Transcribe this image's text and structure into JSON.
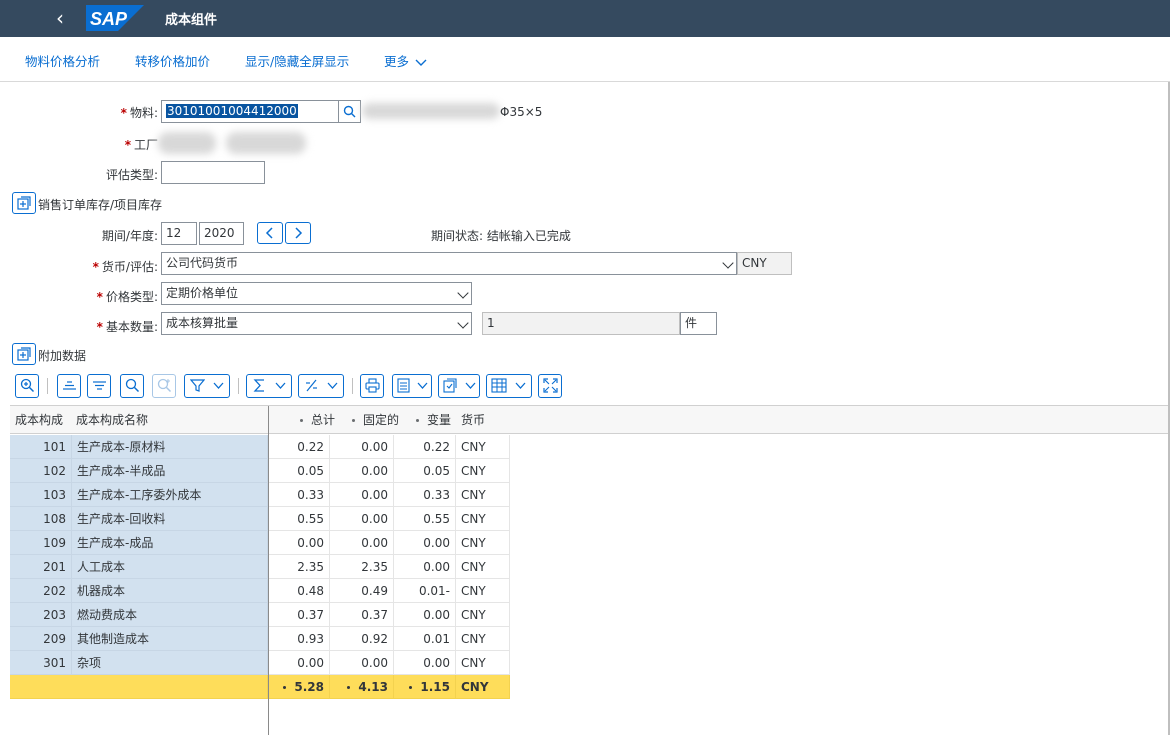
{
  "shell": {
    "title": "成本组件",
    "logo_text": "SAP"
  },
  "toolbar": {
    "items": [
      "物料价格分析",
      "转移价格加价",
      "显示/隐藏全屏显示",
      "更多"
    ]
  },
  "form": {
    "material_label": "物料:",
    "material_value": "30101001004412000",
    "material_desc_suffix": "Φ35×5",
    "plant_label": "工厂",
    "valuation_type_label": "评估类型:",
    "valuation_type_value": "",
    "sales_order_stock": "销售订单库存/项目库存",
    "period_label": "期间/年度:",
    "period_value": "12",
    "year_value": "2020",
    "period_status": "期间状态: 结帐输入已完成",
    "currency_label": "货币/评估:",
    "currency_value": "公司代码货币",
    "currency_code": "CNY",
    "price_type_label": "价格类型:",
    "price_type_value": "定期价格单位",
    "base_qty_label": "基本数量:",
    "base_qty_value": "成本核算批量",
    "base_qty_number": "1",
    "base_qty_unit": "件",
    "additional_data": "附加数据"
  },
  "grid": {
    "headers": {
      "component": "成本构成",
      "component_name": "成本构成名称",
      "total": "总计",
      "fixed": "固定的",
      "variable": "变量",
      "currency": "货币"
    },
    "rows": [
      {
        "code": "101",
        "name": "生产成本-原材料",
        "total": "0.22",
        "fixed": "0.00",
        "variable": "0.22",
        "currency": "CNY"
      },
      {
        "code": "102",
        "name": "生产成本-半成品",
        "total": "0.05",
        "fixed": "0.00",
        "variable": "0.05",
        "currency": "CNY"
      },
      {
        "code": "103",
        "name": "生产成本-工序委外成本",
        "total": "0.33",
        "fixed": "0.00",
        "variable": "0.33",
        "currency": "CNY"
      },
      {
        "code": "108",
        "name": "生产成本-回收料",
        "total": "0.55",
        "fixed": "0.00",
        "variable": "0.55",
        "currency": "CNY"
      },
      {
        "code": "109",
        "name": "生产成本-成品",
        "total": "0.00",
        "fixed": "0.00",
        "variable": "0.00",
        "currency": "CNY"
      },
      {
        "code": "201",
        "name": "人工成本",
        "total": "2.35",
        "fixed": "2.35",
        "variable": "0.00",
        "currency": "CNY"
      },
      {
        "code": "202",
        "name": "机器成本",
        "total": "0.48",
        "fixed": "0.49",
        "variable": "0.01-",
        "currency": "CNY"
      },
      {
        "code": "203",
        "name": "燃动费成本",
        "total": "0.37",
        "fixed": "0.37",
        "variable": "0.00",
        "currency": "CNY"
      },
      {
        "code": "209",
        "name": "其他制造成本",
        "total": "0.93",
        "fixed": "0.92",
        "variable": "0.01",
        "currency": "CNY"
      },
      {
        "code": "301",
        "name": "杂项",
        "total": "0.00",
        "fixed": "0.00",
        "variable": "0.00",
        "currency": "CNY"
      }
    ],
    "totals": {
      "total": "5.28",
      "fixed": "4.13",
      "variable": "1.15",
      "currency": "CNY"
    }
  },
  "colors": {
    "shell": "#354a5f",
    "link": "#0a6ed1",
    "key_col": "#d2e1ef",
    "total_row": "#fedd5a",
    "required": "#bb0000"
  }
}
